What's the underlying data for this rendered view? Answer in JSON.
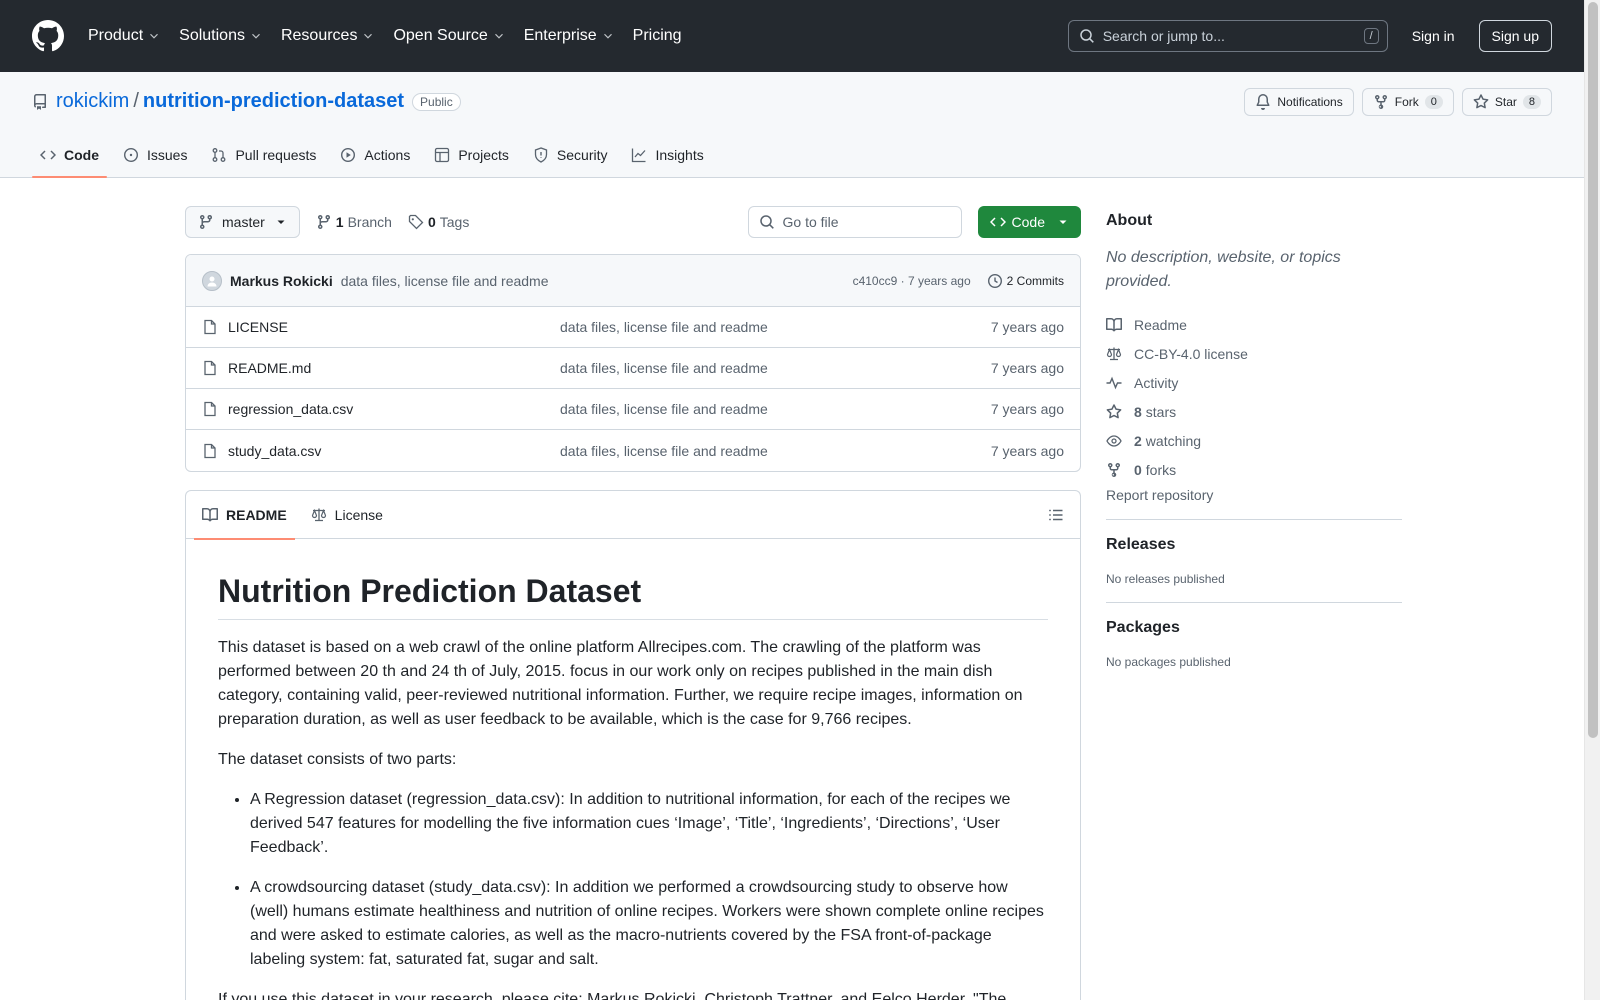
{
  "header": {
    "nav": [
      "Product",
      "Solutions",
      "Resources",
      "Open Source",
      "Enterprise",
      "Pricing"
    ],
    "search_placeholder": "Search or jump to...",
    "search_key": "/",
    "signin": "Sign in",
    "signup": "Sign up"
  },
  "repo": {
    "owner": "rokickim",
    "separator": "/",
    "name": "nutrition-prediction-dataset",
    "visibility": "Public",
    "notifications": "Notifications",
    "fork_label": "Fork",
    "fork_count": "0",
    "star_label": "Star",
    "star_count": "8"
  },
  "tabs": [
    "Code",
    "Issues",
    "Pull requests",
    "Actions",
    "Projects",
    "Security",
    "Insights"
  ],
  "filebar": {
    "branch": "master",
    "branch_count": "1",
    "branch_label": "Branch",
    "tag_count": "0",
    "tag_label": "Tags",
    "goto_placeholder": "Go to file",
    "code_button": "Code"
  },
  "commit": {
    "author": "Markus Rokicki",
    "message": "data files, license file and readme",
    "hash_age": "c410cc9 · 7 years ago",
    "commits": "2 Commits"
  },
  "files": [
    {
      "name": "LICENSE",
      "message": "data files, license file and readme",
      "age": "7 years ago"
    },
    {
      "name": "README.md",
      "message": "data files, license file and readme",
      "age": "7 years ago"
    },
    {
      "name": "regression_data.csv",
      "message": "data files, license file and readme",
      "age": "7 years ago"
    },
    {
      "name": "study_data.csv",
      "message": "data files, license file and readme",
      "age": "7 years ago"
    }
  ],
  "readme": {
    "tabs": [
      "README",
      "License"
    ],
    "title": "Nutrition Prediction Dataset",
    "p1": "This dataset is based on a web crawl of the online platform Allrecipes.com. The crawling of the platform was performed between 20 th and 24 th of July, 2015. focus in our work only on recipes published in the main dish category, containing valid, peer-reviewed nutritional information. Further, we require recipe images, information on preparation duration, as well as user feedback to be available, which is the case for 9,766 recipes.",
    "p2": "The dataset consists of two parts:",
    "li1": "A Regression dataset (regression_data.csv): In addition to nutritional information, for each of the recipes we derived 547 features for modelling the five information cues ‘Image’, ‘Title’, ‘Ingredients’, ‘Directions’, ‘User Feedback’.",
    "li2": "A crowdsourcing dataset (study_data.csv): In addition we performed a crowdsourcing study to observe how (well) humans estimate healthiness and nutrition of online recipes. Workers were shown complete online recipes and were asked to estimate calories, as well as the macro-nutrients covered by the FSA front-of-package labeling system: fat, saturated fat, sugar and salt.",
    "p3": "If you use this dataset in your research, please cite: Markus Rokicki, Christoph Trattner, and Eelco Herder. \"The"
  },
  "about": {
    "title": "About",
    "description": "No description, website, or topics provided.",
    "readme": "Readme",
    "license": "CC-BY-4.0 license",
    "activity": "Activity",
    "stars_count": "8",
    "stars_label": "stars",
    "watching_count": "2",
    "watching_label": "watching",
    "forks_count": "0",
    "forks_label": "forks",
    "report": "Report repository"
  },
  "releases": {
    "title": "Releases",
    "empty": "No releases published"
  },
  "packages": {
    "title": "Packages",
    "empty": "No packages published"
  }
}
